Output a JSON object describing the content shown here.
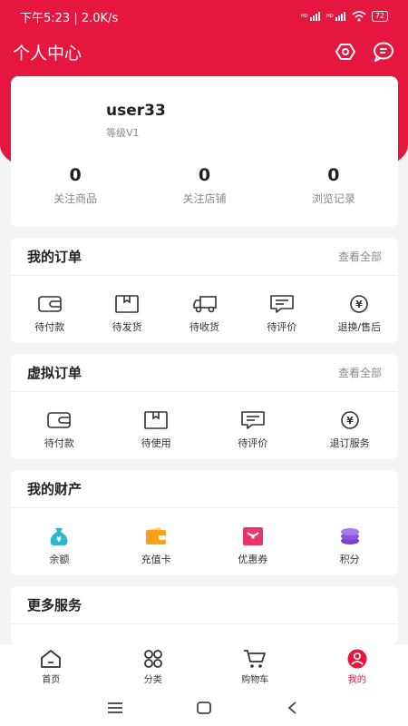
{
  "status": {
    "time": "下午5:23",
    "speed": "2.0K/s",
    "battery": "72"
  },
  "header": {
    "title": "个人中心"
  },
  "profile": {
    "username": "user33",
    "level": "等级V1",
    "stats": [
      {
        "value": "0",
        "label": "关注商品"
      },
      {
        "value": "0",
        "label": "关注店铺"
      },
      {
        "value": "0",
        "label": "浏览记录"
      }
    ]
  },
  "orders": {
    "title": "我的订单",
    "more": "查看全部",
    "items": [
      {
        "label": "待付款",
        "icon": "wallet-icon"
      },
      {
        "label": "待发货",
        "icon": "box-icon"
      },
      {
        "label": "待收货",
        "icon": "truck-icon"
      },
      {
        "label": "待评价",
        "icon": "comment-icon"
      },
      {
        "label": "退换/售后",
        "icon": "refund-icon"
      }
    ]
  },
  "virtual_orders": {
    "title": "虚拟订单",
    "more": "查看全部",
    "items": [
      {
        "label": "待付款",
        "icon": "wallet-icon"
      },
      {
        "label": "待使用",
        "icon": "box-icon"
      },
      {
        "label": "待评价",
        "icon": "comment-icon"
      },
      {
        "label": "退订服务",
        "icon": "refund-icon"
      }
    ]
  },
  "assets": {
    "title": "我的财产",
    "items": [
      {
        "label": "余额",
        "icon": "money-bag-icon",
        "color": "#2fb8c9"
      },
      {
        "label": "充值卡",
        "icon": "card-wallet-icon",
        "color": "#f7a11a"
      },
      {
        "label": "优惠券",
        "icon": "coupon-icon",
        "color": "#e8336d"
      },
      {
        "label": "积分",
        "icon": "points-icon",
        "color": "#8c55e0"
      }
    ]
  },
  "services": {
    "title": "更多服务"
  },
  "tabbar": {
    "active": 3,
    "items": [
      {
        "label": "首页",
        "icon": "home-icon"
      },
      {
        "label": "分类",
        "icon": "category-icon"
      },
      {
        "label": "购物车",
        "icon": "cart-icon"
      },
      {
        "label": "我的",
        "icon": "profile-icon"
      }
    ]
  },
  "colors": {
    "accent": "#e5173f",
    "background": "#f4f4f4"
  }
}
